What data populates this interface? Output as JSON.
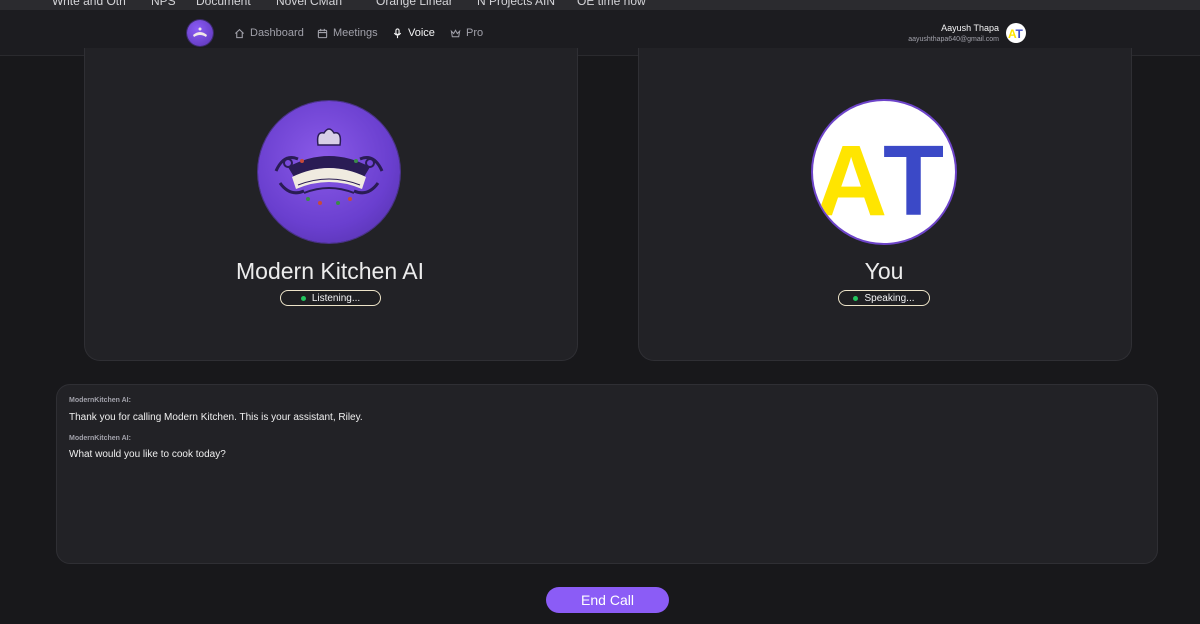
{
  "bookmarks": [
    "Write and Oth",
    "NPS",
    "Document",
    "Novel CMan",
    "Orange Linear",
    "N Projects AIN",
    "OE time now"
  ],
  "nav": {
    "items": [
      {
        "label": "Dashboard",
        "icon": "home-icon"
      },
      {
        "label": "Meetings",
        "icon": "calendar-icon"
      },
      {
        "label": "Voice",
        "icon": "microphone-icon",
        "active": true
      },
      {
        "label": "Pro",
        "icon": "crown-icon"
      }
    ]
  },
  "user": {
    "name": "Aayush Thapa",
    "email": "aayushthapa640@gmail.com",
    "initials": "AT"
  },
  "ai_card": {
    "name": "Modern Kitchen AI",
    "status": "Listening..."
  },
  "user_card": {
    "name": "You",
    "initials": "AT",
    "status": "Speaking..."
  },
  "transcript": [
    {
      "speaker": "ModernKitchen AI:",
      "text": "Thank you for calling Modern Kitchen. This is your assistant, Riley."
    },
    {
      "speaker": "ModernKitchen AI:",
      "text": "What would you like to cook today?"
    }
  ],
  "actions": {
    "end_call": "End Call"
  },
  "colors": {
    "accent": "#8b5cf6",
    "status_dot": "#22c55e",
    "initial_a": "#ffe500",
    "initial_t": "#3b49c7"
  }
}
